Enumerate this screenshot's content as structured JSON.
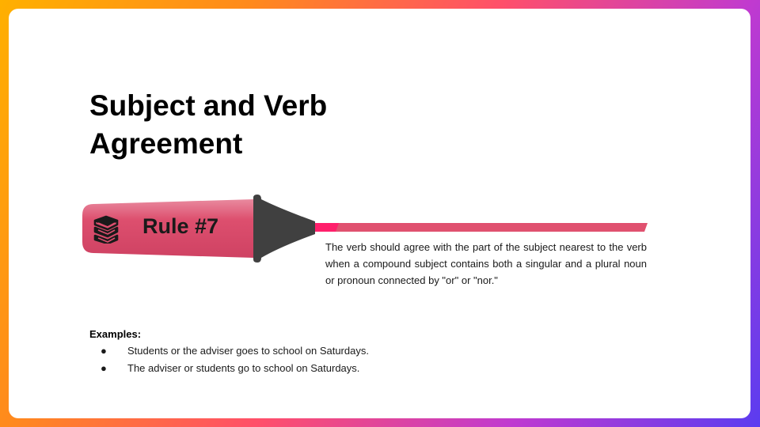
{
  "slide": {
    "title_line1": "Subject and Verb",
    "title_line2": "Agreement",
    "rule_label": "Rule #7",
    "description": "The verb should agree with the part of the subject nearest to the verb when a compound subject contains both a singular and a plural noun or pronoun connected by \"or\" or \"nor.\"",
    "examples_heading": "Examples:",
    "examples": [
      "Students or the adviser goes to school on Saturdays.",
      "The adviser or students go to school on Saturdays."
    ],
    "bullet_char": "●",
    "icon": "books-icon"
  },
  "colors": {
    "marker_body": "#dd4f6e",
    "marker_tip": "#404040",
    "highlight_line": "#e0516f",
    "highlight_accent": "#ff1f6b"
  }
}
